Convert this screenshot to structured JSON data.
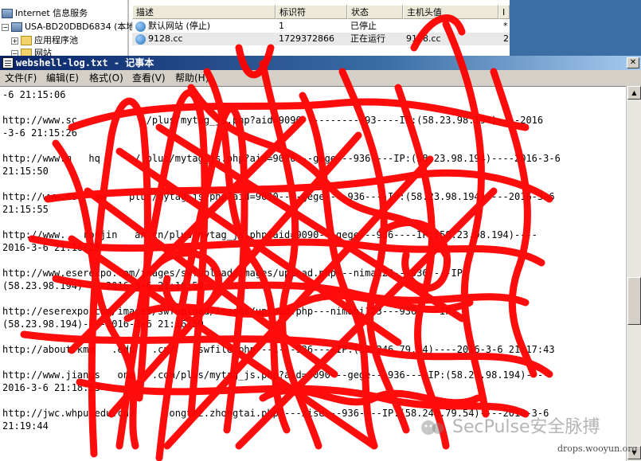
{
  "iis": {
    "tree": [
      {
        "label": "Internet 信息服务",
        "icon": "iis-icon"
      },
      {
        "label": "USA-BD20DBD6834 (本地)",
        "icon": "computer-icon"
      },
      {
        "label": "应用程序池",
        "icon": "folder-icon"
      },
      {
        "label": "网站",
        "icon": "folder-icon"
      }
    ],
    "columns": [
      "描述",
      "标识符",
      "状态",
      "主机头值",
      "I"
    ],
    "rows": [
      {
        "desc": "默认网站 (停止)",
        "id": "1",
        "status": "已停止",
        "host": "",
        "extra": "*"
      },
      {
        "desc": "9128.cc",
        "id": "1729372866",
        "status": "正在运行",
        "host": "9128.cc",
        "extra": "2"
      }
    ]
  },
  "notepad": {
    "title": "webshell-log.txt - 记事本",
    "menu": [
      "文件(F)",
      "编辑(E)",
      "格式(O)",
      "查看(V)",
      "帮助(H)"
    ],
    "lines": [
      "-6 21:15:06",
      "",
      "http://www.sc            /plus/mytag_js.php?aid=9090-----------93----IP:(58.23.98.194)----2016",
      "-3-6 21:15:26",
      "",
      "http://www.m   hq     s/ plus/mytag_js.php?aid=9090---gege---936----IP:(58.23.98.194)----2016-3-6",
      "21:15:50",
      "",
      "http://www.cs   ow    plus/mytag_js.php?aid=9090----gege----936----IP:(58.23.98.194)----2016-3-6",
      "21:15:55",
      "",
      "http://www.   ronjin   an.cn/plus/mytag_js.php?aid=9090---gege---936----IP:(58.23.98.194)----",
      "2016-3-6 21:16:28",
      "",
      "http://www.eserexpo.com/images/swfupload/images/upload.php---nima123---936----IP:",
      "(58.23.98.194)----2016-3-6 21:16:50",
      "",
      "http://eserexpo.com/images/swfupload/images/upload.php---nimabi123---936----IP:",
      "(58.23.98.194)----2016-3-6 21:16:59",
      "",
      "http://about.kmg   .edu   .cn/    swfile.php---1---936----IP:(58.246.79.54)----2016-3-6 21:17:43",
      "",
      "http://www.jiangs   one   .com/plus/mytag_js.php?aid=9090---gege---936----IP:(58.23.98.194)----",
      "2016-3-6 21:18:53",
      "",
      "http://jwc.whpu.edu.cn/      ongtrz.zhongtai.php?---xise---936----IP:(58.246.79.54)----2016-3-6",
      "21:19:44"
    ]
  },
  "watermark": {
    "brand": "SecPulse安全脉搏",
    "site": "drops.wooyun.org"
  },
  "colors": {
    "scribble": "#ff0000",
    "titlebar": "#0a246a",
    "window": "#d4d0c8"
  }
}
